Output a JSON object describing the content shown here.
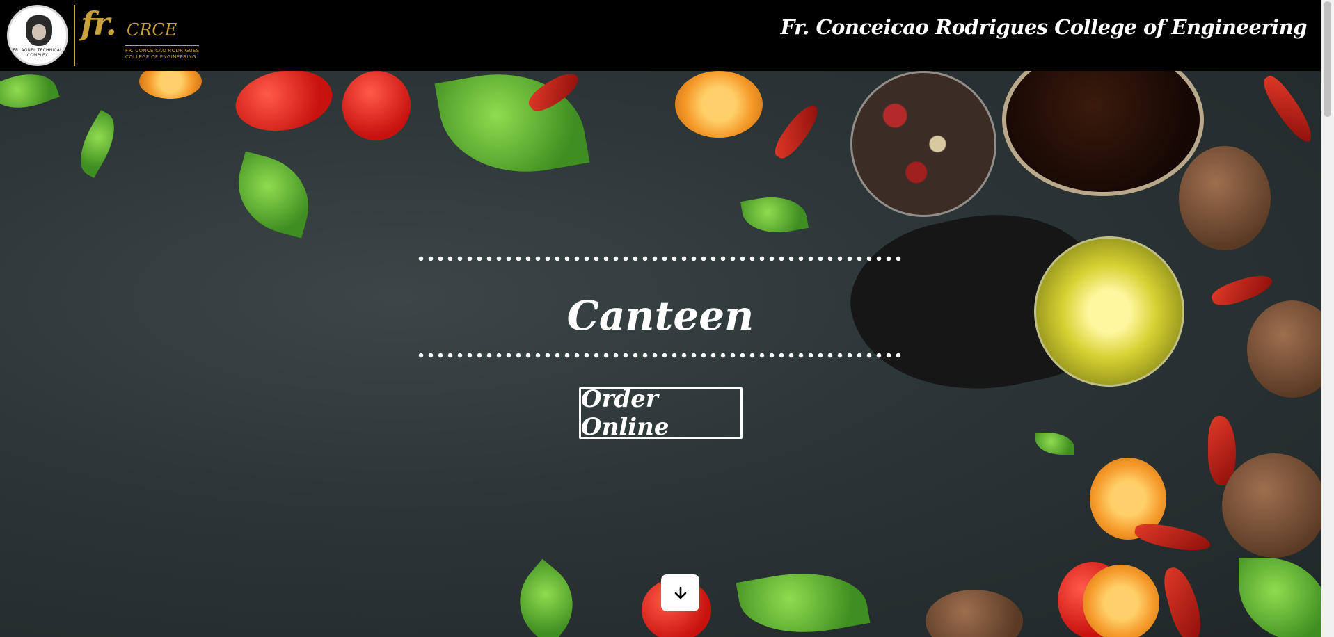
{
  "header": {
    "seal_text": "FR. AGNEL TECHNICAL COMPLEX",
    "brand_mark": "fr.",
    "brand_sub": "CRCE",
    "brand_line1": "FR. CONCEICAO RODRIGUES",
    "brand_line2": "COLLEGE OF ENGINEERING",
    "college_name": "Fr. Conceicao Rodrigues College of Engineering"
  },
  "hero": {
    "title": "Canteen",
    "order_button_label": "Order Online",
    "scroll_icon": "arrow-down-icon"
  },
  "colors": {
    "header_bg": "#000000",
    "accent_gold": "#c9a13d",
    "text": "#ffffff"
  }
}
